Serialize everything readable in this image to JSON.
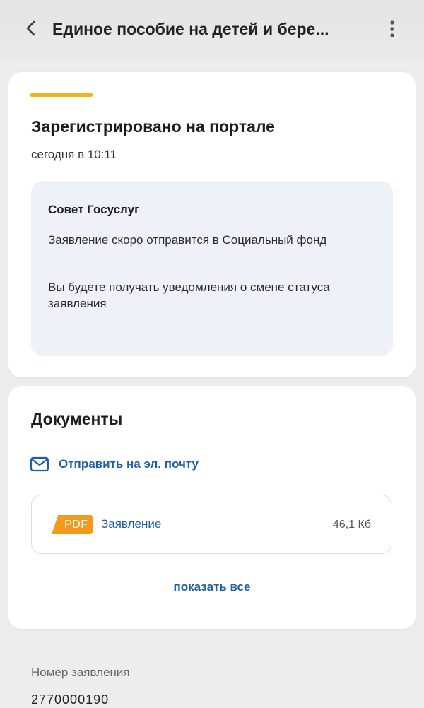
{
  "header": {
    "title": "Единое пособие на детей и бере...",
    "back_icon": "chevron-left-icon",
    "more_icon": "vertical-dots-icon"
  },
  "status_card": {
    "title": "Зарегистрировано на портале",
    "time": "сегодня в 10:11",
    "accent_color": "#f4b21c",
    "tip": {
      "title": "Совет Госуслуг",
      "paragraphs": [
        "Заявление скоро отправится в Социальный фонд",
        "Вы будете получать уведомления о смене статуса заявления"
      ]
    }
  },
  "documents_card": {
    "title": "Документы",
    "email_action": {
      "icon": "envelope-icon",
      "label": "Отправить на эл. почту"
    },
    "files": [
      {
        "badge": "PDF",
        "name": "Заявление",
        "size": "46,1 Кб"
      }
    ],
    "show_all_label": "показать все"
  },
  "application_number": {
    "label": "Номер заявления",
    "value": "2770000190"
  },
  "colors": {
    "link": "#1f5fa8",
    "pdf_badge": "#f39a1e",
    "tip_background": "#eef1f7",
    "page_background": "#ededed"
  }
}
